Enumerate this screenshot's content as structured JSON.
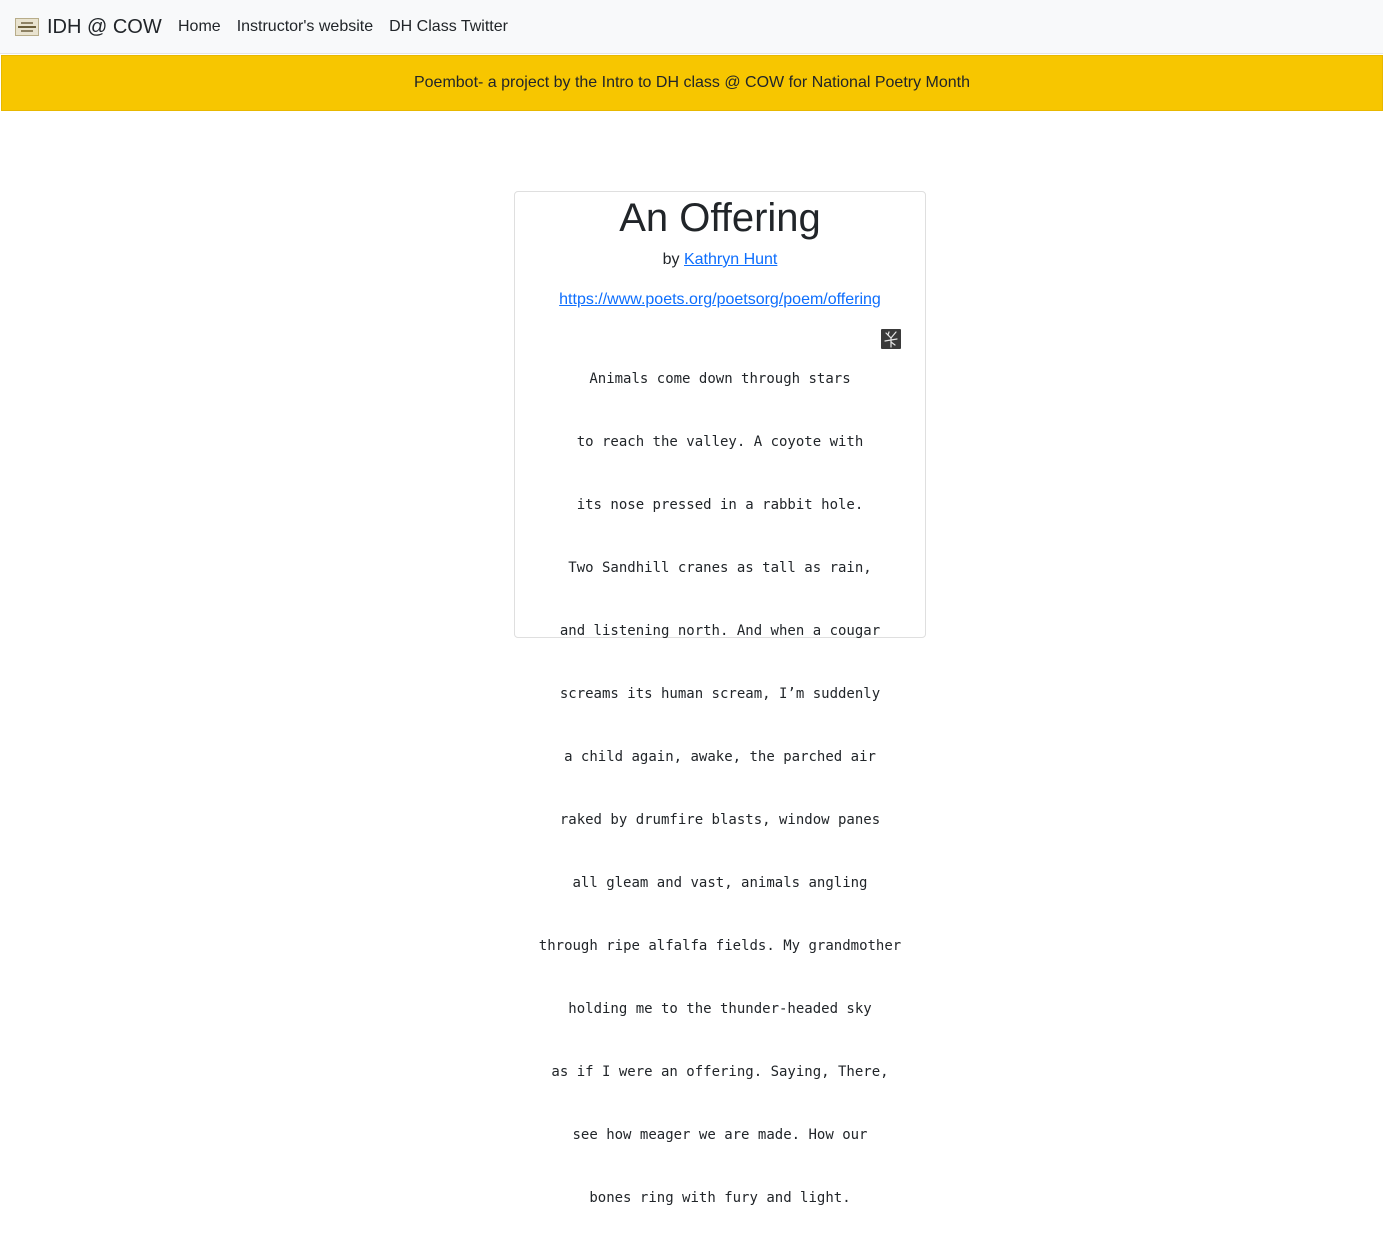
{
  "navbar": {
    "brand_text": "IDH @ COW",
    "links": [
      {
        "label": "Home"
      },
      {
        "label": "Instructor's website"
      },
      {
        "label": "DH Class Twitter"
      }
    ]
  },
  "banner": {
    "text": "Poembot- a project by the Intro to DH class @ COW for National Poetry Month"
  },
  "poem": {
    "title": "An Offering",
    "byline_prefix": "by",
    "author": "Kathryn Hunt",
    "source_url": "https://www.poets.org/poetsorg/poem/offering",
    "lines": [
      "Animals come down through stars",
      "to reach the valley. A coyote with",
      "its nose pressed in a rabbit hole.",
      "Two Sandhill cranes as tall as rain,",
      "and listening north. And when a cougar",
      "screams its human scream, I’m suddenly",
      "a child again, awake, the parched air",
      "raked by drumfire blasts, window panes",
      "all gleam and vast, animals angling",
      "through ripe alfalfa fields. My grandmother",
      "holding me to the thunder-headed sky",
      "as if I were an offering. Saying, There,",
      "see how meager we are made. How our",
      "bones ring with fury and light."
    ]
  },
  "colors": {
    "navbar_bg": "#f8f9fa",
    "banner_bg": "#f7c600",
    "link": "#0d6efd"
  },
  "icons": {
    "brand": "wooster-logo-icon",
    "poem": "crane-image-icon"
  }
}
